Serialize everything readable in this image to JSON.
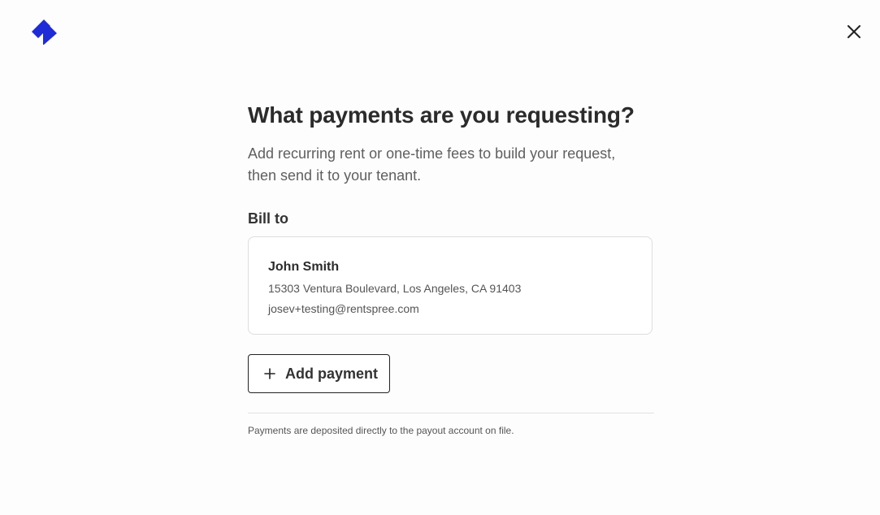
{
  "header": {
    "logo_icon": "rentspree-logo-icon",
    "brand_color": "#1f2bd6",
    "close_icon": "close-icon"
  },
  "main": {
    "title": "What payments are you requesting?",
    "subtitle_line1": "Add recurring rent or one-time fees to build your request,",
    "subtitle_line2": "then send it to your tenant.",
    "bill_to_label": "Bill to",
    "bill_to": {
      "name": "John Smith",
      "address": "15303 Ventura Boulevard, Los Angeles, CA 91403",
      "email": "josev+testing@rentspree.com"
    },
    "add_payment_label": "Add payment",
    "add_payment_icon": "plus-icon",
    "footnote": "Payments are deposited directly to the payout account on file."
  }
}
